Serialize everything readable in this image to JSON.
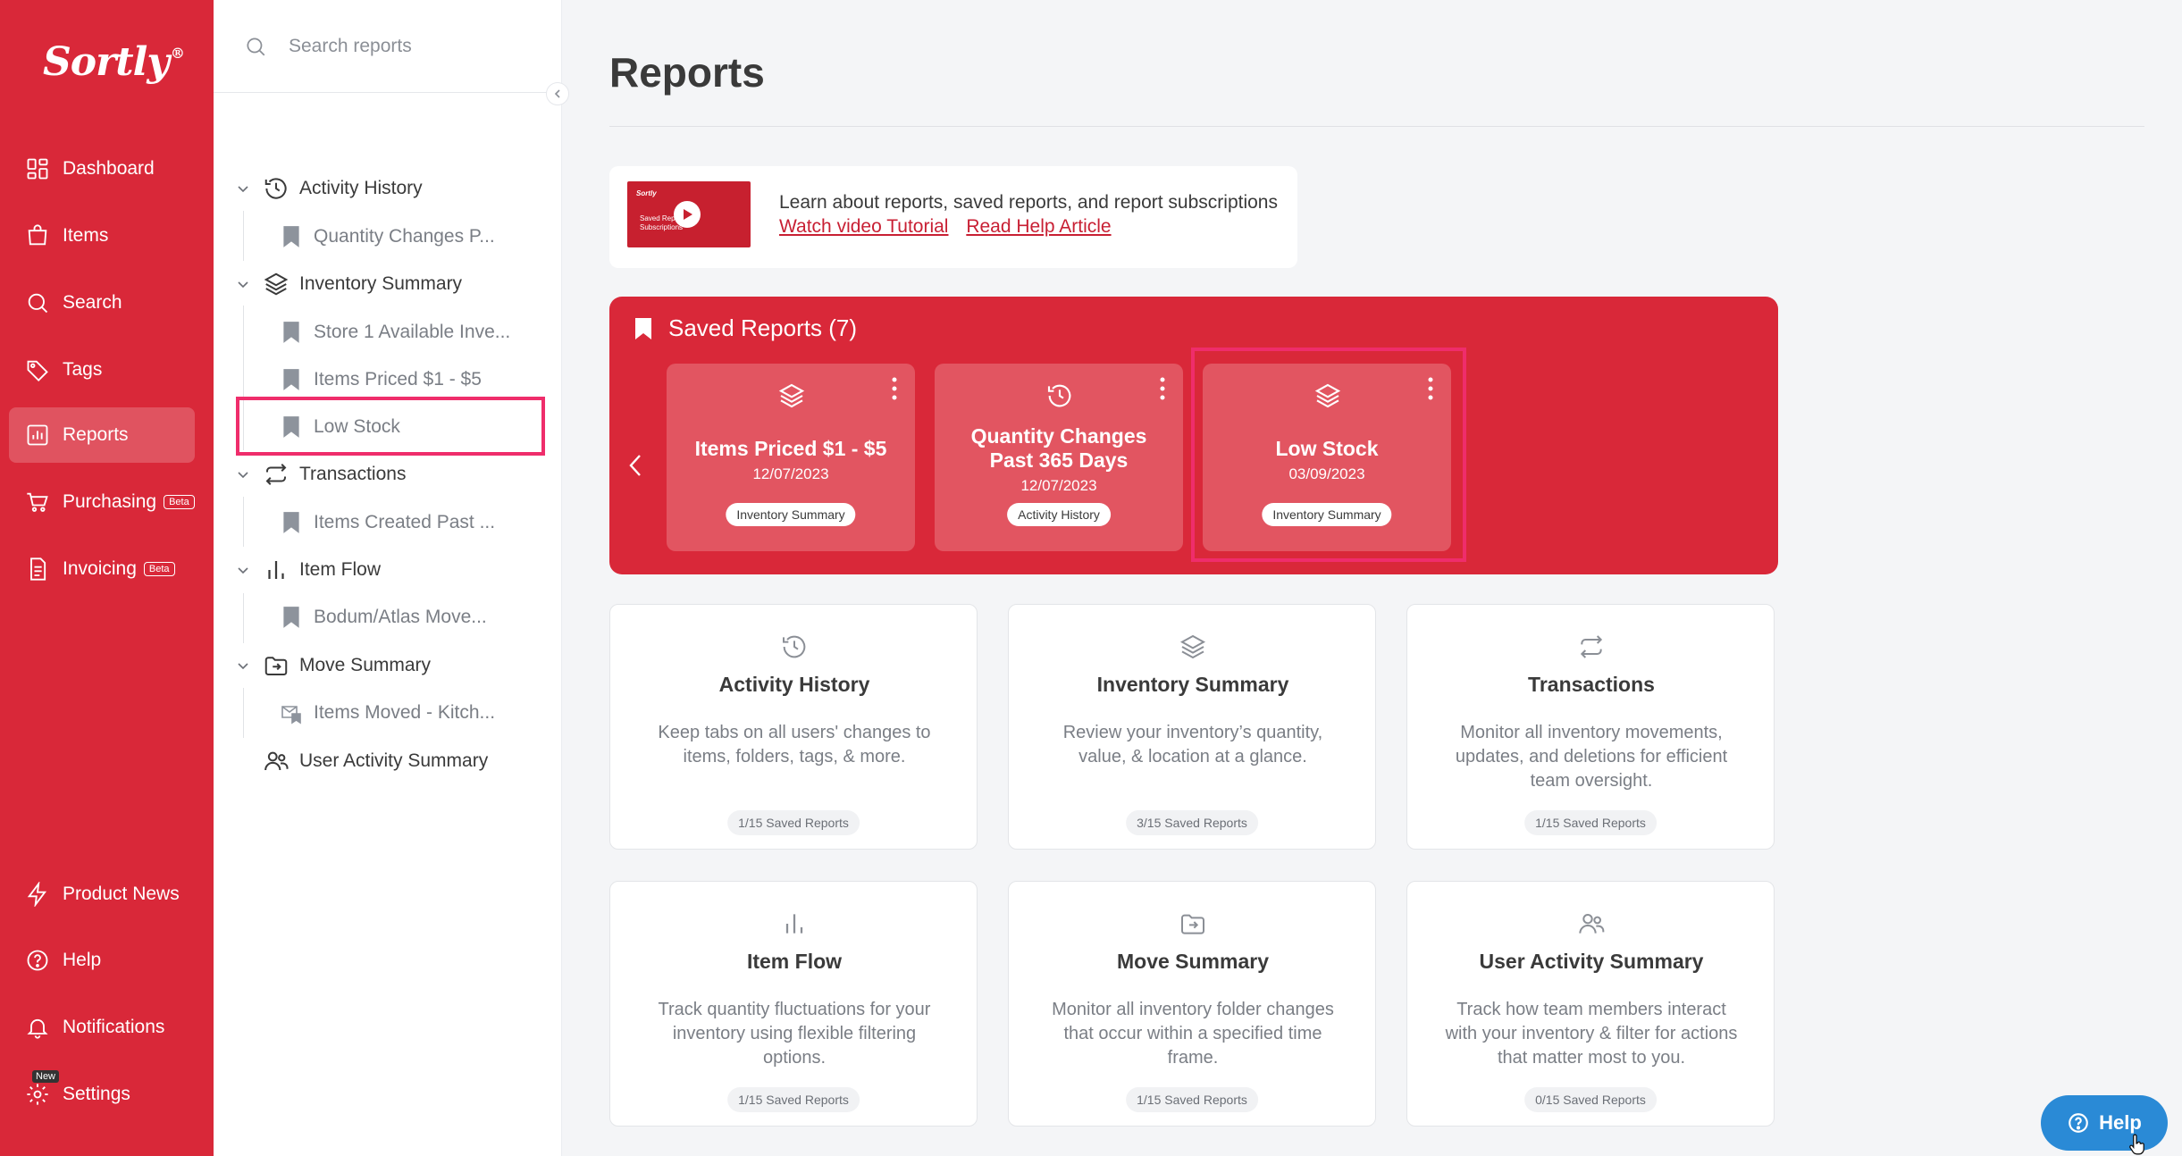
{
  "app": {
    "logo_text": "Sortly",
    "logo_mark": "®"
  },
  "nav": {
    "items": [
      {
        "label": "Dashboard",
        "icon": "dashboard-icon"
      },
      {
        "label": "Items",
        "icon": "items-icon"
      },
      {
        "label": "Search",
        "icon": "search-icon"
      },
      {
        "label": "Tags",
        "icon": "tag-icon"
      },
      {
        "label": "Reports",
        "icon": "reports-icon",
        "active": true
      },
      {
        "label": "Purchasing",
        "icon": "cart-icon",
        "badge": "Beta"
      },
      {
        "label": "Invoicing",
        "icon": "invoice-icon",
        "badge": "Beta"
      }
    ],
    "bottom": [
      {
        "label": "Product News",
        "icon": "lightning-icon"
      },
      {
        "label": "Help",
        "icon": "help-icon"
      },
      {
        "label": "Notifications",
        "icon": "bell-icon"
      },
      {
        "label": "Settings",
        "icon": "gear-icon",
        "badge": "New"
      }
    ]
  },
  "panel": {
    "search_placeholder": "Search reports",
    "tree": [
      {
        "label": "Activity History",
        "icon": "history-icon",
        "children": [
          "Quantity Changes P..."
        ]
      },
      {
        "label": "Inventory Summary",
        "icon": "layers-icon",
        "children": [
          "Store 1 Available Inve...",
          "Items Priced $1 - $5",
          "Low Stock"
        ]
      },
      {
        "label": "Transactions",
        "icon": "transfer-icon",
        "children": [
          "Items Created Past ..."
        ]
      },
      {
        "label": "Item Flow",
        "icon": "bar-chart-icon",
        "children": [
          "Bodum/Atlas Move..."
        ]
      },
      {
        "label": "Move Summary",
        "icon": "move-icon",
        "children": [
          "Items Moved - Kitch..."
        ]
      },
      {
        "label": "User Activity Summary",
        "icon": "users-icon",
        "children": []
      }
    ]
  },
  "main": {
    "title": "Reports",
    "tutorial": {
      "text": "Learn about reports, saved reports, and report subscriptions",
      "link_video": "Watch video Tutorial",
      "link_article": "Read Help Article",
      "thumb_logo": "Sortly",
      "thumb_text": "Saved Reports Subscriptions"
    },
    "saved": {
      "title": "Saved Reports (7)",
      "cards": [
        {
          "name": "Items Priced $1 - $5",
          "date": "12/07/2023",
          "tag": "Inventory Summary",
          "icon": "layers-icon"
        },
        {
          "name": "Quantity Changes Past 365 Days",
          "date": "12/07/2023",
          "tag": "Activity History",
          "icon": "history-icon"
        },
        {
          "name": "Low Stock",
          "date": "03/09/2023",
          "tag": "Inventory Summary",
          "icon": "layers-icon"
        }
      ]
    },
    "report_types": [
      {
        "name": "Activity History",
        "desc": "Keep tabs on all users' changes to items, folders, tags, & more.",
        "count": "1/15 Saved Reports",
        "icon": "history-icon"
      },
      {
        "name": "Inventory Summary",
        "desc": "Review your inventory’s quantity, value, & location at a glance.",
        "count": "3/15 Saved Reports",
        "icon": "layers-icon"
      },
      {
        "name": "Transactions",
        "desc": "Monitor all inventory movements, updates, and deletions for efficient team oversight.",
        "count": "1/15 Saved Reports",
        "icon": "transfer-icon"
      },
      {
        "name": "Item Flow",
        "desc": "Track quantity fluctuations for your inventory using flexible filtering options.",
        "count": "1/15 Saved Reports",
        "icon": "bar-chart-icon"
      },
      {
        "name": "Move Summary",
        "desc": "Monitor all inventory folder changes that occur within a specified time frame.",
        "count": "1/15 Saved Reports",
        "icon": "move-icon"
      },
      {
        "name": "User Activity Summary",
        "desc": "Track how team members interact with your inventory & filter for actions that matter most to you.",
        "count": "0/15 Saved Reports",
        "icon": "users-icon"
      }
    ]
  },
  "help_button": {
    "label": "Help"
  }
}
